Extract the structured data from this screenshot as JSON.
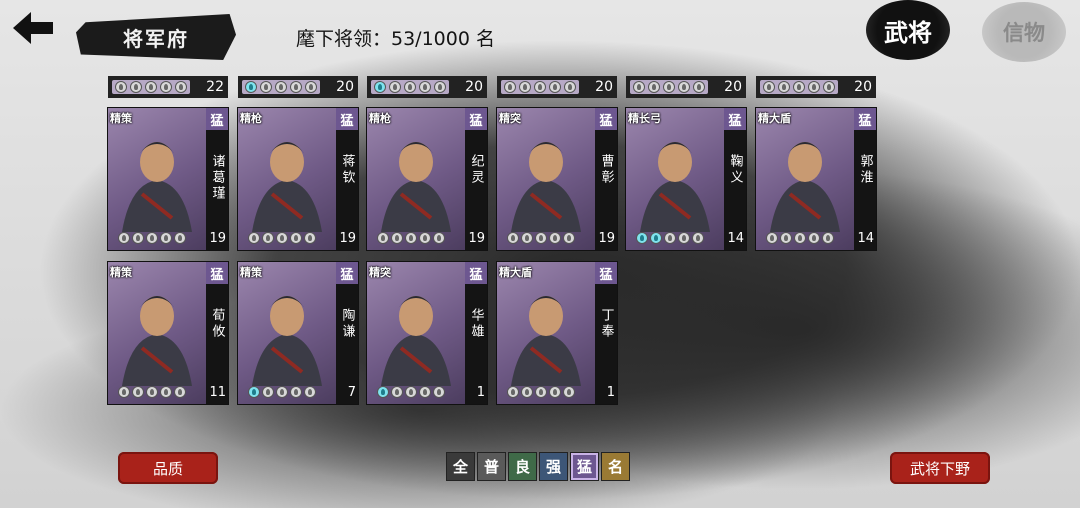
{
  "header": {
    "title": "将军府",
    "count_label": "麾下将领：53/1000 名"
  },
  "tabs": [
    {
      "label": "武将",
      "active": true
    },
    {
      "label": "信物",
      "active": false
    }
  ],
  "top_strip_levels": [
    "22",
    "20",
    "20",
    "20",
    "20",
    "20"
  ],
  "cards": [
    {
      "name": "诸葛瑾",
      "class": "精策",
      "grade": "猛",
      "level": "19",
      "stars_on": 0
    },
    {
      "name": "蒋钦",
      "class": "精枪",
      "grade": "猛",
      "level": "19",
      "stars_on": 0
    },
    {
      "name": "纪灵",
      "class": "精枪",
      "grade": "猛",
      "level": "19",
      "stars_on": 0
    },
    {
      "name": "曹彰",
      "class": "精突",
      "grade": "猛",
      "level": "19",
      "stars_on": 0
    },
    {
      "name": "鞠义",
      "class": "精长弓",
      "grade": "猛",
      "level": "14",
      "stars_on": 2
    },
    {
      "name": "郭淮",
      "class": "精大盾",
      "grade": "猛",
      "level": "14",
      "stars_on": 0
    },
    {
      "name": "荀攸",
      "class": "精策",
      "grade": "猛",
      "level": "11",
      "stars_on": 0
    },
    {
      "name": "陶谦",
      "class": "精策",
      "grade": "猛",
      "level": "7",
      "stars_on": 1
    },
    {
      "name": "华雄",
      "class": "精突",
      "grade": "猛",
      "level": "1",
      "stars_on": 1
    },
    {
      "name": "丁奉",
      "class": "精大盾",
      "grade": "猛",
      "level": "1",
      "stars_on": 0
    }
  ],
  "bottom": {
    "quality_label": "品质",
    "dismiss_label": "武将下野",
    "filters": [
      {
        "label": "全",
        "color": "#3a3a3a"
      },
      {
        "label": "普",
        "color": "#5a5a5a"
      },
      {
        "label": "良",
        "color": "#3f6a48"
      },
      {
        "label": "强",
        "color": "#3d5677"
      },
      {
        "label": "猛",
        "color": "#6d5790"
      },
      {
        "label": "名",
        "color": "#9a7a34"
      }
    ]
  },
  "colors": {
    "accent_red": "#a9221a",
    "grade_purple": "#6d5790",
    "star_active": "#7fe3ee"
  },
  "icons": [
    "back-arrow-icon",
    "soul-orb-icon"
  ]
}
